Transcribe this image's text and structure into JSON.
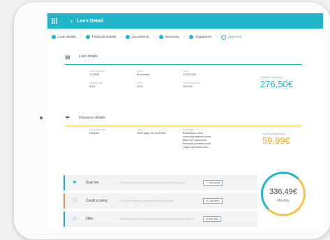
{
  "app": {
    "title": "Loan Detail"
  },
  "steps": [
    {
      "label": "Loan details",
      "state": "done"
    },
    {
      "label": "Financial details",
      "state": "done"
    },
    {
      "label": "Documents",
      "state": "done"
    },
    {
      "label": "Summary",
      "state": "done"
    },
    {
      "label": "Signatures",
      "state": "done"
    },
    {
      "label": "Approval",
      "state": "active"
    }
  ],
  "loan_details": {
    "title": "Loan details",
    "fields": [
      {
        "label": "Loan amount",
        "value": "12,000€"
      },
      {
        "label": "Term",
        "value": "60 months"
      },
      {
        "label": "Total",
        "value": "12,312,000"
      },
      {
        "label": "Interest rate",
        "value": "5.4%"
      },
      {
        "label": "APR",
        "value": "5.6%"
      },
      {
        "label": "Processing fees",
        "value": "100,000"
      }
    ],
    "installment_label": "Monthly installment",
    "installment_value": "276,50€",
    "accent": "#20b5cb"
  },
  "insurance_details": {
    "title": "Insurance details",
    "fields": [
      {
        "label": "Insurance plan",
        "value": "Full plan"
      },
      {
        "label": "Type",
        "value": "Third party, fire and theft"
      },
      {
        "label": "Coverage",
        "value": "Breakdown cover\nIndemnity waivers cover\nBlind hire plan cover\nPersonal accident cover\nLegal expenses cover"
      }
    ],
    "installment_label": "Monthly installment",
    "installment_value": "59,99€",
    "accent": "#f5c242"
  },
  "rows": [
    {
      "name": "Goal set",
      "icon": "goal-icon",
      "accent": "#20b5cb",
      "desc": "The application has the logged into the account after adding a goal",
      "button": "View goal"
    },
    {
      "name": "Credit scoring",
      "icon": "alert-icon",
      "accent": "#f08a3c",
      "desc": "We could not extract your credit scoring from this page",
      "button": "Call client"
    },
    {
      "name": "Offer",
      "icon": "offer-icon",
      "accent": "#20b5cb",
      "desc": "BPM Bank offer for this payment with client's increased insurance offer plan",
      "button": "Add offer"
    }
  ],
  "summary": {
    "amount": "336,49€",
    "frequency": "Monthly"
  }
}
